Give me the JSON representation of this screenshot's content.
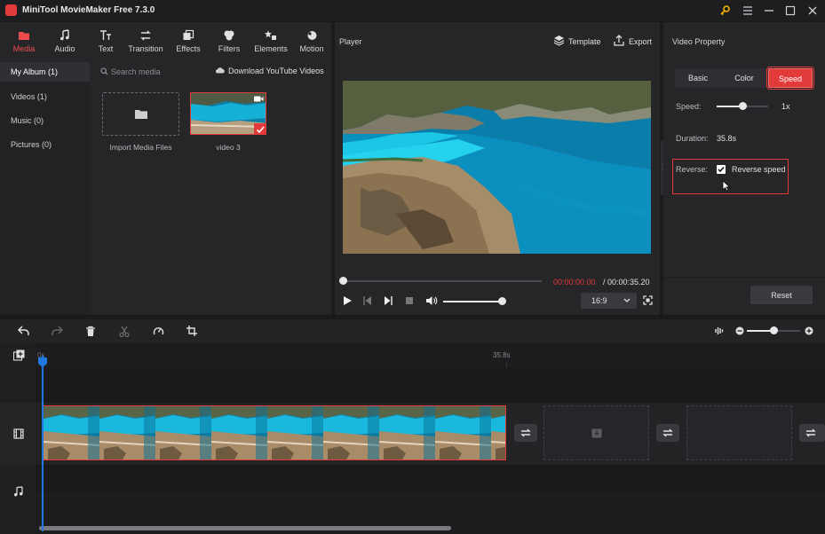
{
  "app": {
    "title": "MiniTool MovieMaker Free 7.3.0"
  },
  "toolbar": {
    "tools": [
      {
        "label": "Media"
      },
      {
        "label": "Audio"
      },
      {
        "label": "Text"
      },
      {
        "label": "Transition"
      },
      {
        "label": "Effects"
      },
      {
        "label": "Filters"
      },
      {
        "label": "Elements"
      },
      {
        "label": "Motion"
      }
    ]
  },
  "sidebar": {
    "items": [
      {
        "label": "My Album (1)"
      },
      {
        "label": "Videos (1)"
      },
      {
        "label": "Music (0)"
      },
      {
        "label": "Pictures (0)"
      }
    ]
  },
  "media": {
    "search_placeholder": "Search media",
    "download_label": "Download YouTube Videos",
    "import_label": "Import Media Files",
    "clip_label": "video 3"
  },
  "player": {
    "title": "Player",
    "template_label": "Template",
    "export_label": "Export",
    "current_time": "00:00:00.00",
    "total_time": "/ 00:00:35.20",
    "aspect": "16:9",
    "progress": 0,
    "volume": 1.0
  },
  "property": {
    "title": "Video Property",
    "tabs": [
      {
        "label": "Basic"
      },
      {
        "label": "Color"
      },
      {
        "label": "Speed"
      }
    ],
    "speed_label": "Speed:",
    "speed_value": "1x",
    "speed_level": 0.5,
    "duration_label": "Duration:",
    "duration_value": "35.8s",
    "reverse_label": "Reverse:",
    "reverse_checkbox_label": "Reverse speed",
    "reverse_checked": true,
    "reset_label": "Reset"
  },
  "timeline": {
    "ruler_start": "0s",
    "ruler_mark": "35.8s",
    "zoom_level": 0.5
  },
  "colors": {
    "accent": "#e23a3a",
    "active_text": "#ef4d4d",
    "playhead": "#1f78e0"
  }
}
